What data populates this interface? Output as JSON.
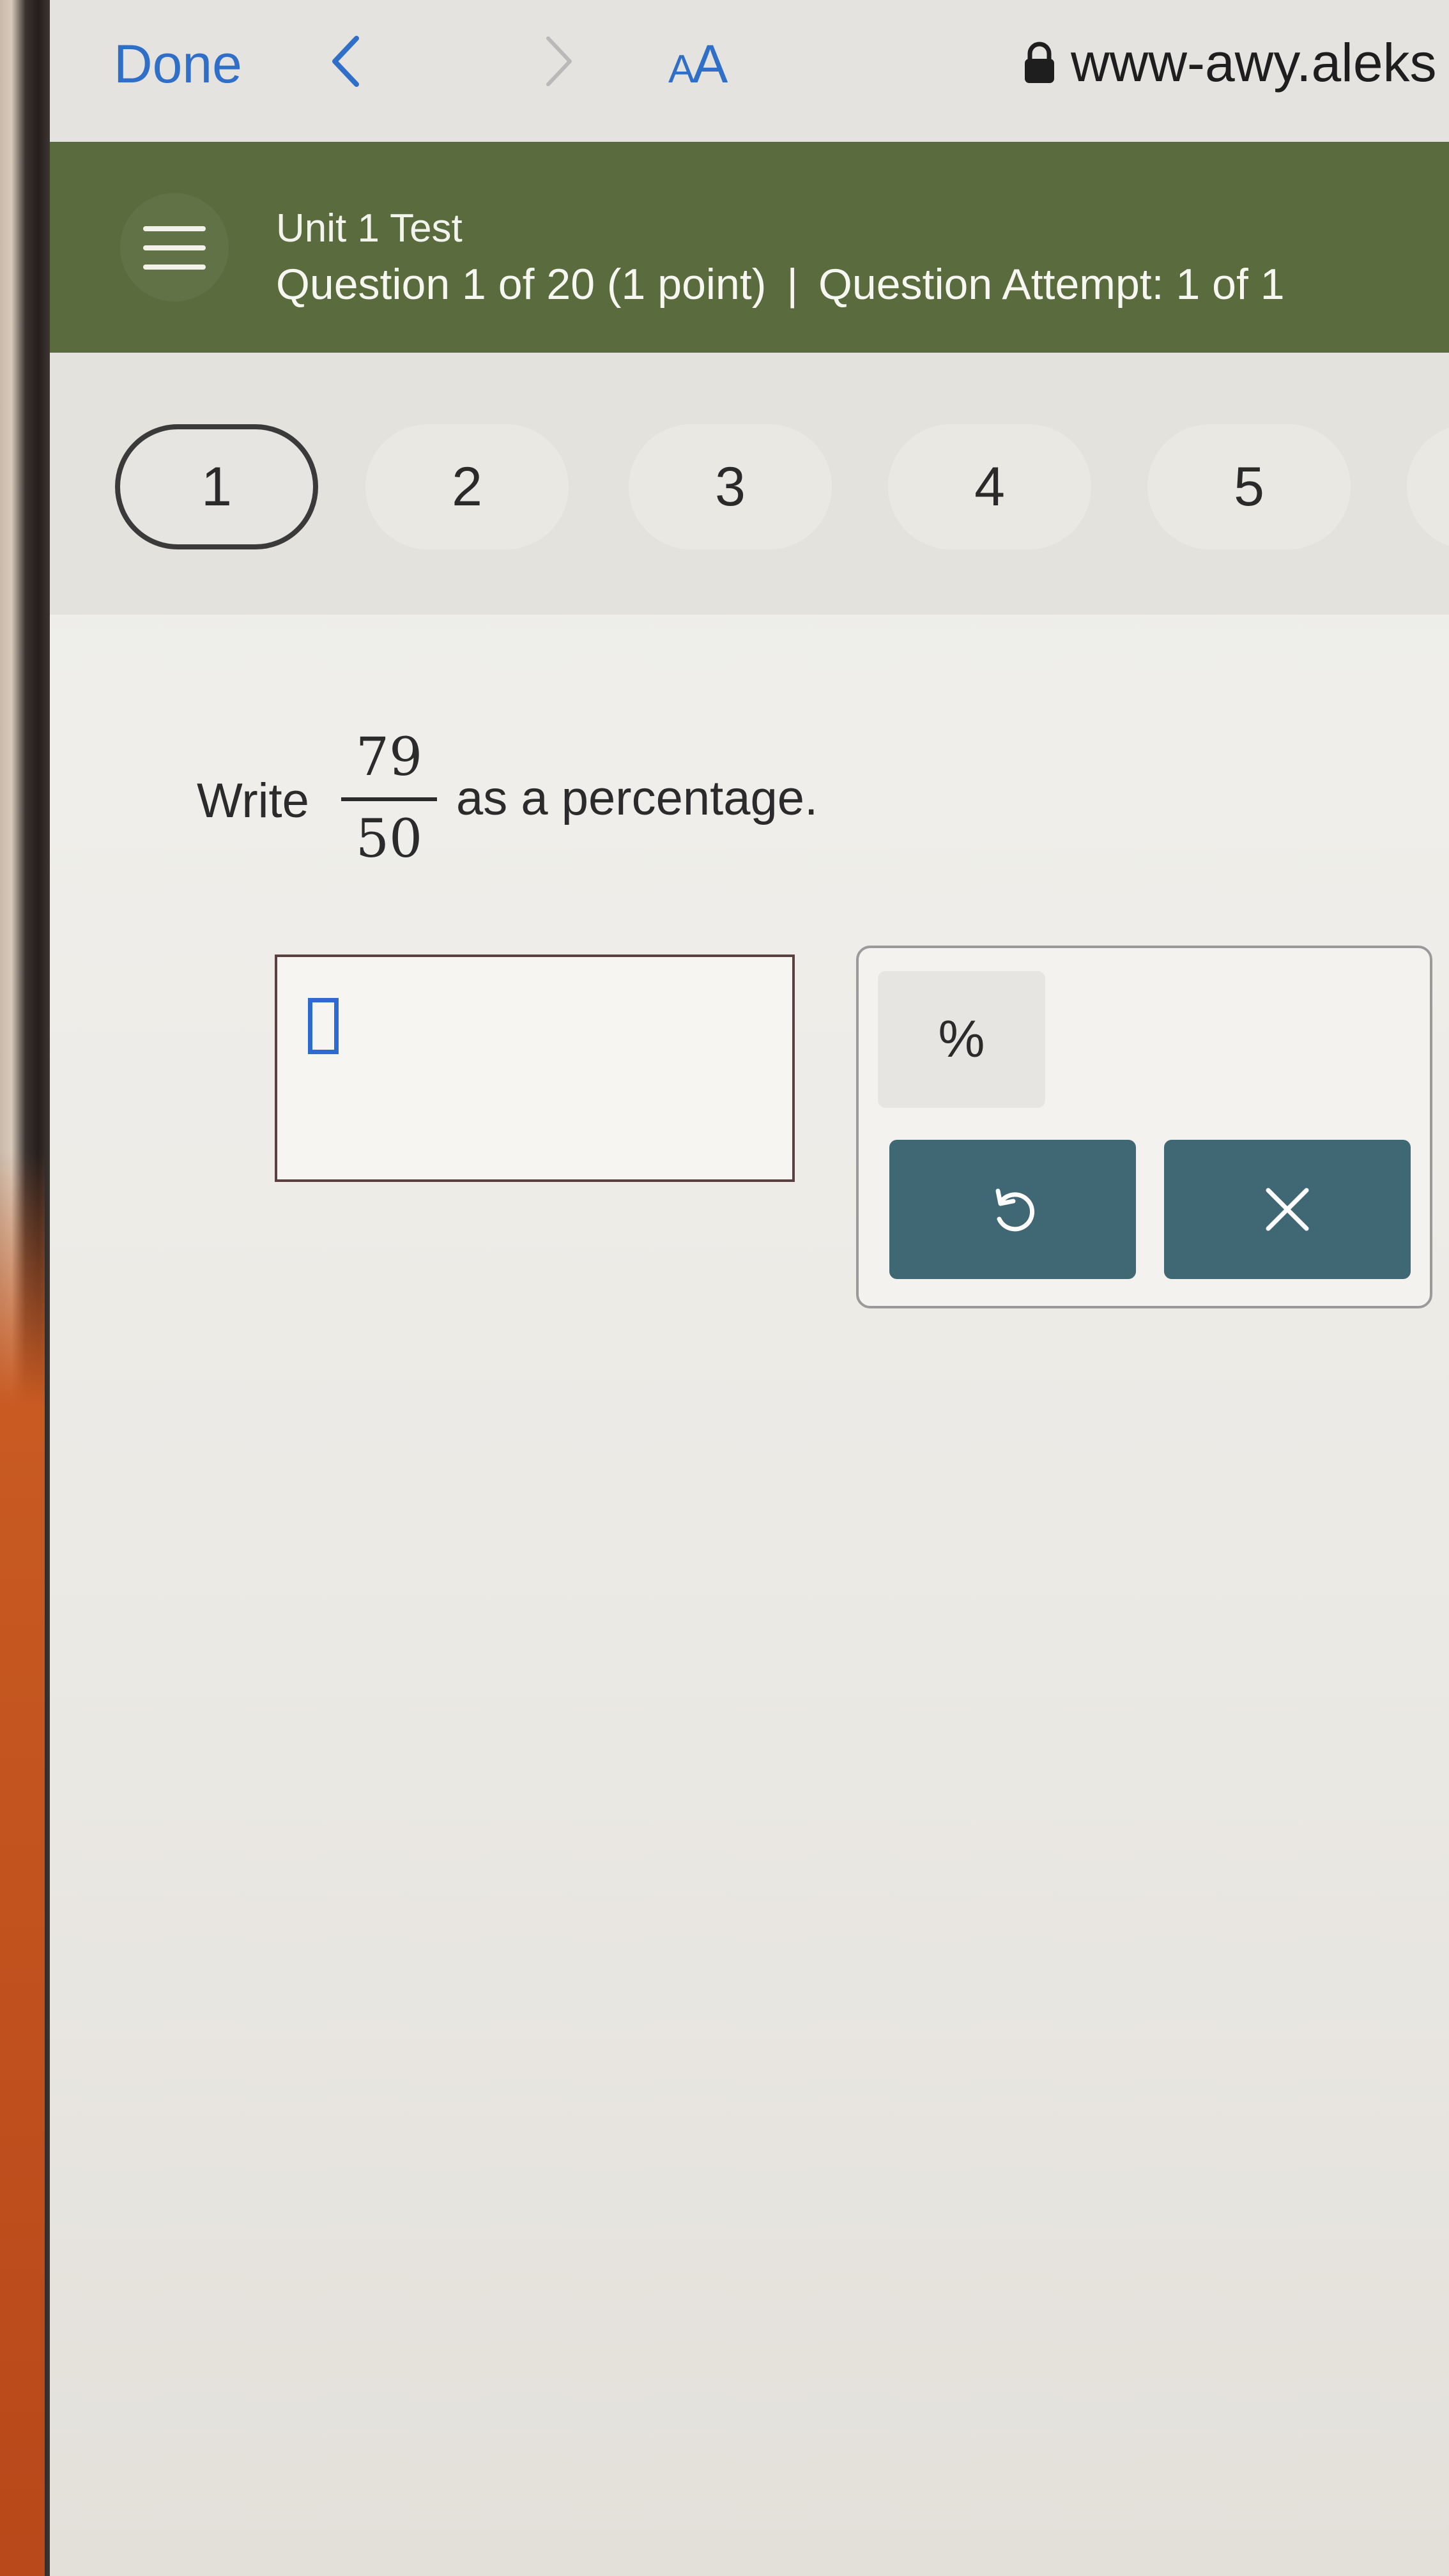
{
  "browser": {
    "done_label": "Done",
    "text_size_small": "A",
    "text_size_large": "A",
    "url": "www-awy.aleks"
  },
  "header": {
    "title": "Unit 1 Test",
    "question_info": "Question 1 of 20 (1 point)",
    "separator": "|",
    "attempt_info": "Question Attempt: 1 of 1"
  },
  "question_nav": {
    "items": [
      {
        "label": "1",
        "active": true
      },
      {
        "label": "2",
        "active": false
      },
      {
        "label": "3",
        "active": false
      },
      {
        "label": "4",
        "active": false
      },
      {
        "label": "5",
        "active": false
      }
    ]
  },
  "question": {
    "prefix": "Write",
    "numerator": "79",
    "denominator": "50",
    "suffix": "as a percentage."
  },
  "answer": {
    "value": ""
  },
  "keypad": {
    "percent_label": "%",
    "undo_icon": "undo-icon",
    "clear_icon": "close-icon"
  },
  "colors": {
    "header_green": "#5a6b3e",
    "link_blue": "#2f6fc7",
    "keypad_teal": "#3f6874",
    "cursor_blue": "#2d6bd0"
  }
}
